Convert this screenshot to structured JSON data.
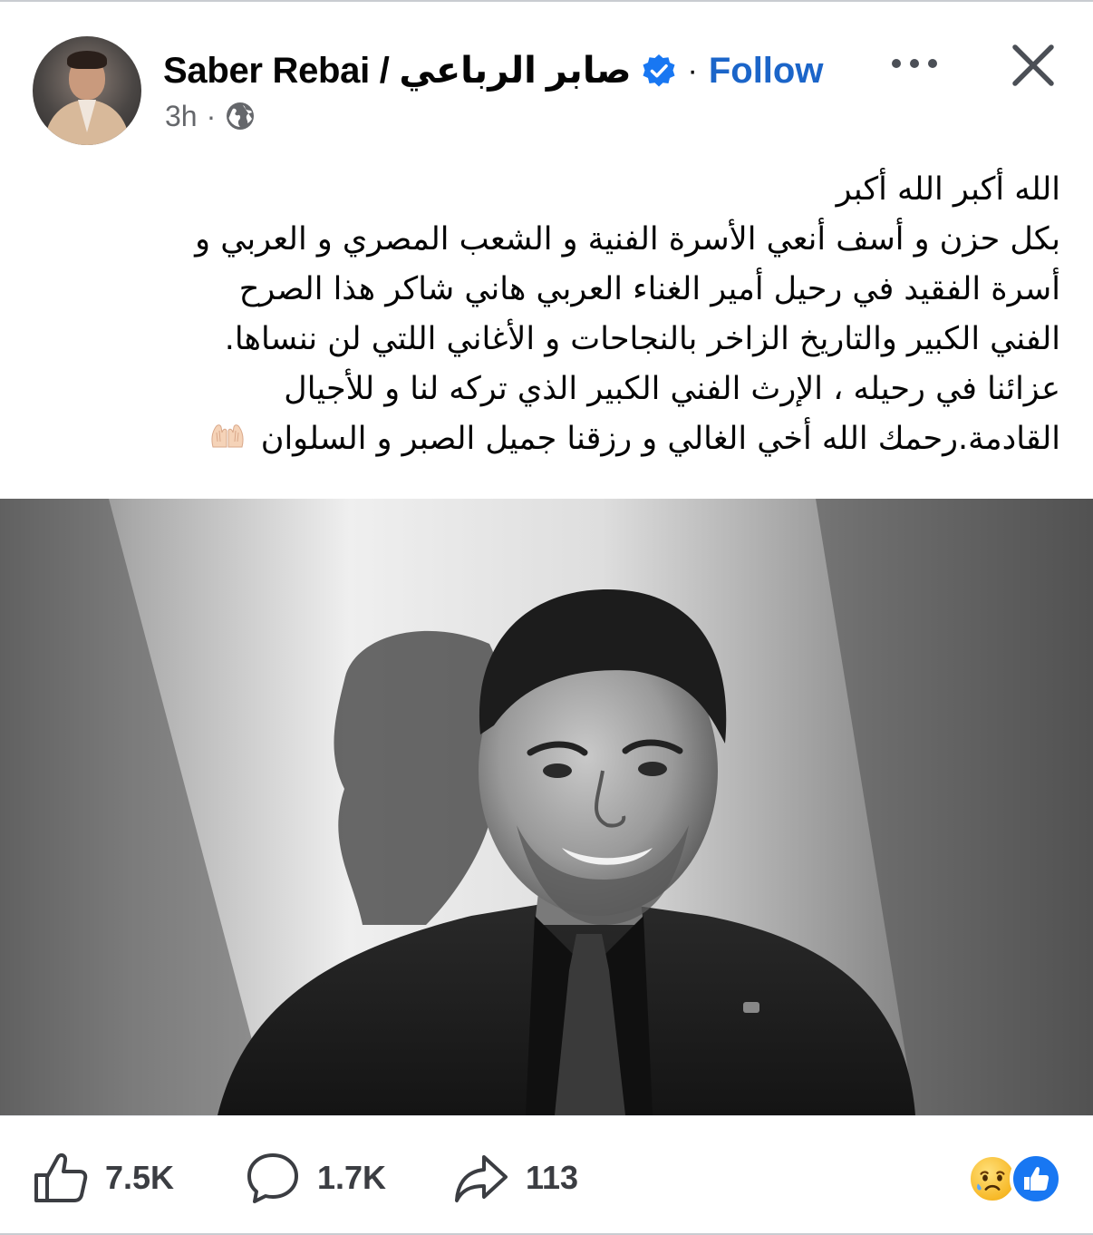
{
  "post": {
    "author": "Saber Rebai / صابر  الرباعي",
    "separator": "·",
    "follow_label": "Follow",
    "time": "3h",
    "meta_separator": "·",
    "icons": {
      "verified": "verified-badge-icon",
      "privacy": "globe-icon",
      "more": "more-options-icon",
      "close": "close-icon"
    },
    "text_lines": [
      "الله أكبر الله أكبر",
      "بكل حزن و أسف أنعي الأسرة الفنية و الشعب المصري و العربي و",
      "أسرة الفقيد في رحيل أمير الغناء العربي هاني شاكر  هذا الصرح",
      "الفني الكبير والتاريخ الزاخر بالنجاحات و الأغاني اللتي لن ننساها.",
      "عزائنا في رحيله ، الإرث الفني الكبير الذي تركه لنا و للأجيال",
      "القادمة.رحمك الله أخي الغالي و رزقنا جميل الصبر و السلوان"
    ],
    "text_emoji": "praying-hands-icon"
  },
  "actions": {
    "likes": "7.5K",
    "comments": "1.7K",
    "shares": "113",
    "reaction_icons": [
      "sad-reaction-icon",
      "like-reaction-icon"
    ]
  },
  "colors": {
    "follow": "#1b65c9",
    "verified": "#1877f2",
    "secondary_text": "#65676b"
  }
}
